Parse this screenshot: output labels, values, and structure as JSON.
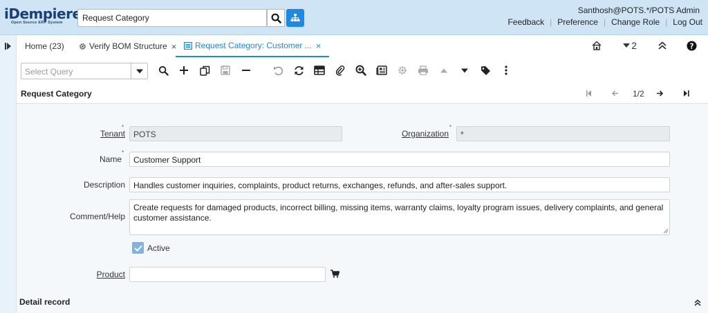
{
  "header": {
    "logo_text": "iDempiere",
    "logo_subtitle": "Open Source ERP System",
    "search_value": "Request Category",
    "user": "Santhosh@POTS.*/POTS Admin",
    "links": [
      "Feedback",
      "Preference",
      "Change Role",
      "Log Out"
    ]
  },
  "tabs": {
    "items": [
      {
        "label": "Home (23)"
      },
      {
        "label": "Verify BOM Structure"
      },
      {
        "label": "Request Category: Customer ..."
      }
    ],
    "count": "2",
    "close_glyph": "×"
  },
  "toolbar": {
    "query_placeholder": "Select Query"
  },
  "window": {
    "title": "Request Category",
    "record_nav": "1/2"
  },
  "form": {
    "tenant_label": "Tenant",
    "tenant_value": "POTS",
    "org_label": "Organization",
    "org_value": "*",
    "name_label": "Name",
    "name_value": "Customer Support",
    "description_label": "Description",
    "description_value": "Handles customer inquiries, complaints, product returns, exchanges, refunds, and after-sales support.",
    "comment_label": "Comment/Help",
    "comment_value": "Create requests for damaged products, incorrect billing, missing items, warranty claims, loyalty program issues, delivery complaints, and general customer assistance.",
    "active_label": "Active",
    "active_checked": true,
    "product_label": "Product",
    "product_value": "",
    "required_mark": "*"
  },
  "detail": {
    "title": "Detail record"
  },
  "colors": {
    "accent": "#1e88e5",
    "header_bg": "#cfe5f5",
    "form_bg": "#f4f8fb"
  }
}
